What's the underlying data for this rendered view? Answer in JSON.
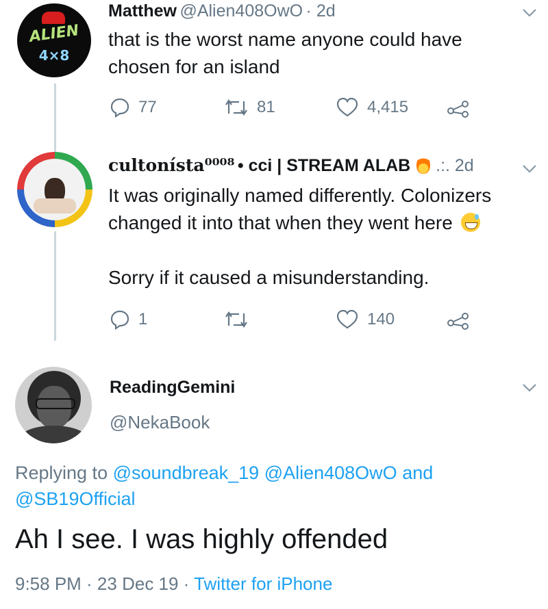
{
  "tweet1": {
    "display_name": "Matthew",
    "handle": "@Alien408OwO",
    "time": "· 2d",
    "text_line1": "that is the worst name anyone could have",
    "text_line2": "chosen for an island",
    "replies": "77",
    "retweets": "81",
    "likes": "4,415",
    "avatar_text_top": "ALIEN",
    "avatar_text_bottom": "4×8"
  },
  "tweet2": {
    "display_name": "cultonísta⁰⁰⁰⁸",
    "display_name_rest": "• cci | STREAM ALAB",
    "time": ".:. 2d",
    "text_line1": "It was originally named differently. Colonizers",
    "text_line2": "changed it into that when they went here",
    "text_line3": "Sorry if it caused a misunderstanding.",
    "replies": "1",
    "retweets": "",
    "likes": "140"
  },
  "main_tweet": {
    "display_name": "ReadingGemini",
    "handle": "@NekaBook",
    "replying_prefix": "Replying to",
    "replying_to_1": "@soundbreak_19",
    "replying_to_2": "@Alien408OwO",
    "replying_and": "and",
    "replying_to_3": "@SB19Official",
    "text": "Ah I see. I was highly offended",
    "timestamp": "9:58 PM · 23 Dec 19 ·",
    "source": "Twitter for iPhone"
  },
  "colors": {
    "link": "#1da1f2",
    "secondary": "#657786",
    "primary": "#14171a",
    "thread_line": "#ccd6dd"
  }
}
